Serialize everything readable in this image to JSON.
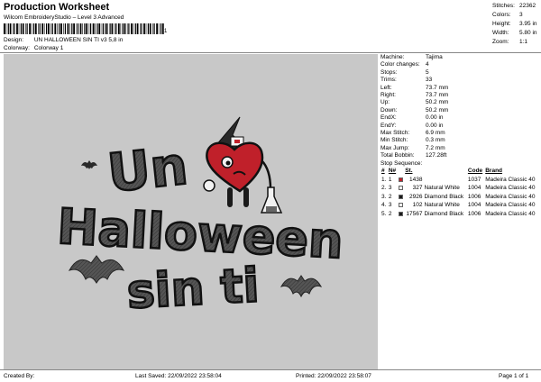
{
  "header": {
    "title": "Production Worksheet",
    "subtitle": "Wilcom EmbroideryStudio – Level 3 Advanced",
    "barcode_digit": "1",
    "design_label": "Design:",
    "design_value": "UN HALLOWEEN SIN TI v3 5,8 in",
    "colorway_label": "Colorway:",
    "colorway_value": "Colorway 1"
  },
  "stats": [
    {
      "label": "Stitches:",
      "value": "22362"
    },
    {
      "label": "Colors:",
      "value": "3"
    },
    {
      "label": "Height:",
      "value": "3.95 in"
    },
    {
      "label": "Width:",
      "value": "5.80 in"
    },
    {
      "label": "Zoom:",
      "value": "1:1"
    }
  ],
  "design": {
    "lines": [
      "Un",
      "Halloween",
      "sin ti"
    ],
    "thread_colors": {
      "outline": "#1a1a1a",
      "fill": "#4a4a4a",
      "red": "#c0202a",
      "white": "#f2f2f2"
    }
  },
  "properties": [
    {
      "label": "Machine:",
      "value": "Tajima"
    },
    {
      "label": "Color changes:",
      "value": "4"
    },
    {
      "label": "Stops:",
      "value": "5"
    },
    {
      "label": "Trims:",
      "value": "33"
    },
    {
      "label": "Left:",
      "value": "73.7 mm"
    },
    {
      "label": "Right:",
      "value": "73.7 mm"
    },
    {
      "label": "Up:",
      "value": "50.2 mm"
    },
    {
      "label": "Down:",
      "value": "50.2 mm"
    },
    {
      "label": "EndX:",
      "value": "0.00 in"
    },
    {
      "label": "EndY:",
      "value": "0.00 in"
    },
    {
      "label": "Max Stitch:",
      "value": "6.9 mm"
    },
    {
      "label": "Min Stitch:",
      "value": "0.3 mm"
    },
    {
      "label": "Max Jump:",
      "value": "7.2 mm"
    },
    {
      "label": "Total Bobbin:",
      "value": "127.28ft"
    }
  ],
  "stop_sequence": {
    "title": "Stop Sequence:",
    "headers": [
      "#",
      "N#",
      "St.",
      "Code",
      "Brand"
    ],
    "rows": [
      {
        "num": "1.",
        "n": "1",
        "color": "#c0202a",
        "st": "1438",
        "name": "",
        "code": "1037",
        "brand": "Madeira Classic 40"
      },
      {
        "num": "2.",
        "n": "3",
        "color": "#f4f4f0",
        "st": "327",
        "name": "Natural White",
        "code": "1004",
        "brand": "Madeira Classic 40"
      },
      {
        "num": "3.",
        "n": "2",
        "color": "#1a1a1a",
        "st": "2926",
        "name": "Diamond Black",
        "code": "1006",
        "brand": "Madeira Classic 40"
      },
      {
        "num": "4.",
        "n": "3",
        "color": "#f4f4f0",
        "st": "102",
        "name": "Natural White",
        "code": "1004",
        "brand": "Madeira Classic 40"
      },
      {
        "num": "5.",
        "n": "2",
        "color": "#1a1a1a",
        "st": "17567",
        "name": "Diamond Black",
        "code": "1006",
        "brand": "Madeira Classic 40"
      }
    ]
  },
  "footer": {
    "created_by": "Created By:",
    "last_saved": "Last Saved: 22/09/2022 23:58:04",
    "printed": "Printed: 22/09/2022 23:58:07",
    "page": "Page 1 of 1"
  }
}
